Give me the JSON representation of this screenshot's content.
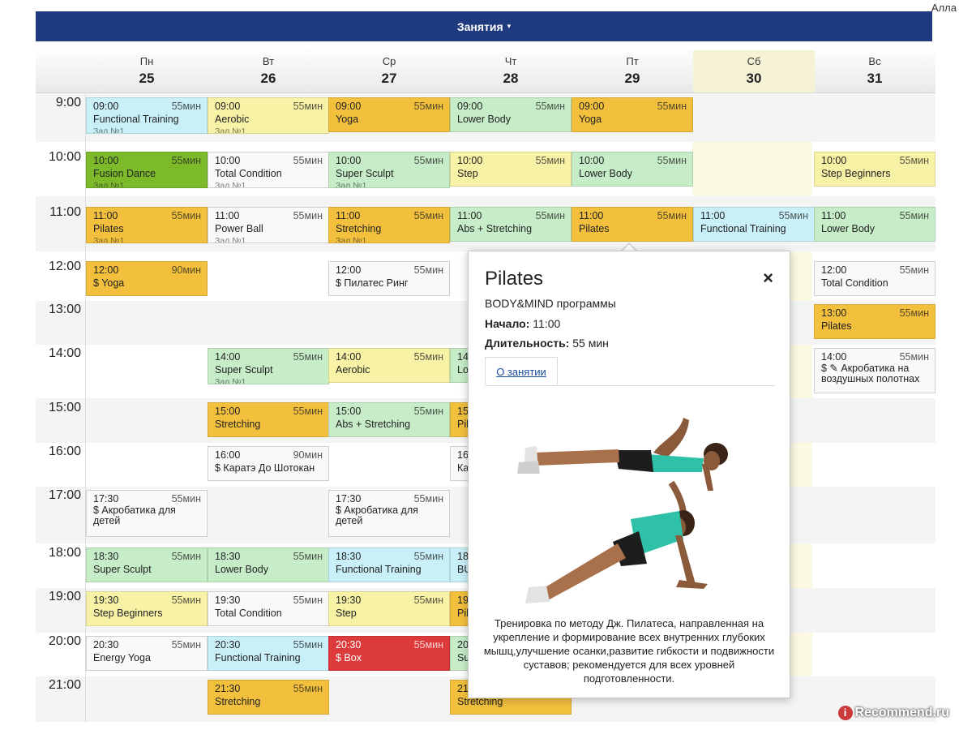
{
  "user": {
    "name": "Алла"
  },
  "topbar": {
    "label": "Занятия",
    "caret": "▾"
  },
  "days": [
    {
      "name": "Пн",
      "date": "25"
    },
    {
      "name": "Вт",
      "date": "26"
    },
    {
      "name": "Ср",
      "date": "27"
    },
    {
      "name": "Чт",
      "date": "28"
    },
    {
      "name": "Пт",
      "date": "29"
    },
    {
      "name": "Сб",
      "date": "30"
    },
    {
      "name": "Вс",
      "date": "31"
    }
  ],
  "times": [
    "9:00",
    "10:00",
    "11:00",
    "12:00",
    "13:00",
    "14:00",
    "15:00",
    "16:00",
    "17:00",
    "18:00",
    "19:00",
    "20:00",
    "21:00"
  ],
  "colors": {
    "cyan": "#c9f0f8",
    "yellow": "#f7f2a6",
    "orange": "#f2c03d",
    "green": "#c6edc8",
    "white": "#f9f9f9",
    "darkgreen": "#7cba2a",
    "red": "#dd3b3b",
    "topbar": "#1f3a7e"
  },
  "events": [
    {
      "day": 0,
      "slot": 0,
      "time": "09:00",
      "dur": "55мин",
      "title": "Functional Training",
      "room": "Зал №1",
      "color": "cyan"
    },
    {
      "day": 1,
      "slot": 0,
      "time": "09:00",
      "dur": "55мин",
      "title": "Aerobic",
      "room": "Зал №1",
      "color": "yellow"
    },
    {
      "day": 2,
      "slot": 0,
      "time": "09:00",
      "dur": "55мин",
      "title": "Yoga",
      "color": "orange"
    },
    {
      "day": 3,
      "slot": 0,
      "time": "09:00",
      "dur": "55мин",
      "title": "Lower Body",
      "color": "green"
    },
    {
      "day": 4,
      "slot": 0,
      "time": "09:00",
      "dur": "55мин",
      "title": "Yoga",
      "color": "orange"
    },
    {
      "day": 0,
      "slot": 1,
      "time": "10:00",
      "dur": "55мин",
      "title": "Fusion Dance",
      "room": "Зал №1",
      "color": "darkgreen"
    },
    {
      "day": 1,
      "slot": 1,
      "time": "10:00",
      "dur": "55мин",
      "title": "Total Condition",
      "room": "Зал №1",
      "color": "white"
    },
    {
      "day": 2,
      "slot": 1,
      "time": "10:00",
      "dur": "55мин",
      "title": "Super Sculpt",
      "room": "Зал №1",
      "color": "green"
    },
    {
      "day": 3,
      "slot": 1,
      "time": "10:00",
      "dur": "55мин",
      "title": "Step",
      "color": "yellow"
    },
    {
      "day": 4,
      "slot": 1,
      "time": "10:00",
      "dur": "55мин",
      "title": "Lower Body",
      "color": "green"
    },
    {
      "day": 6,
      "slot": 1,
      "time": "10:00",
      "dur": "55мин",
      "title": "Step Beginners",
      "color": "yellow"
    },
    {
      "day": 0,
      "slot": 2,
      "time": "11:00",
      "dur": "55мин",
      "title": "Pilates",
      "room": "Зал №1",
      "color": "orange"
    },
    {
      "day": 1,
      "slot": 2,
      "time": "11:00",
      "dur": "55мин",
      "title": "Power Ball",
      "room": "Зал №1",
      "color": "white"
    },
    {
      "day": 2,
      "slot": 2,
      "time": "11:00",
      "dur": "55мин",
      "title": "Stretching",
      "room": "Зал №1",
      "color": "orange"
    },
    {
      "day": 3,
      "slot": 2,
      "time": "11:00",
      "dur": "55мин",
      "title": "Abs + Stretching",
      "color": "green"
    },
    {
      "day": 4,
      "slot": 2,
      "time": "11:00",
      "dur": "55мин",
      "title": "Pilates",
      "color": "orange"
    },
    {
      "day": 5,
      "slot": 2,
      "time": "11:00",
      "dur": "55мин",
      "title": "Functional Training",
      "color": "cyan"
    },
    {
      "day": 6,
      "slot": 2,
      "time": "11:00",
      "dur": "55мин",
      "title": "Lower Body",
      "color": "green"
    },
    {
      "day": 0,
      "slot": 3,
      "time": "12:00",
      "dur": "90мин",
      "title": "$ Yoga",
      "color": "orange"
    },
    {
      "day": 2,
      "slot": 3,
      "time": "12:00",
      "dur": "55мин",
      "title": "$ Пилатес Ринг",
      "color": "white"
    },
    {
      "day": 6,
      "slot": 3,
      "time": "12:00",
      "dur": "55мин",
      "title": "Total Condition",
      "color": "white"
    },
    {
      "day": 6,
      "slot": 4,
      "time": "13:00",
      "dur": "55мин",
      "title": "Pilates",
      "color": "orange"
    },
    {
      "day": 1,
      "slot": 5,
      "time": "14:00",
      "dur": "55мин",
      "title": "Super Sculpt",
      "room": "Зал №1",
      "color": "green"
    },
    {
      "day": 2,
      "slot": 5,
      "time": "14:00",
      "dur": "55мин",
      "title": "Aerobic",
      "color": "yellow"
    },
    {
      "day": 6,
      "slot": 5,
      "time": "14:00",
      "dur": "55мин",
      "title": "$ ✎ Акробатика на воздушных полотнах",
      "color": "white",
      "wrap": true
    },
    {
      "day": 1,
      "slot": 6,
      "time": "15:00",
      "dur": "55мин",
      "title": "Stretching",
      "color": "orange"
    },
    {
      "day": 2,
      "slot": 6,
      "time": "15:00",
      "dur": "55мин",
      "title": "Abs + Stretching",
      "color": "green"
    },
    {
      "day": 1,
      "slot": 7,
      "time": "16:00",
      "dur": "90мин",
      "title": "$ Каратэ До Шотокан",
      "color": "white"
    },
    {
      "day": 0,
      "slot": 8,
      "time": "17:30",
      "dur": "55мин",
      "title": "$ Акробатика для детей",
      "color": "white",
      "wrap": true
    },
    {
      "day": 2,
      "slot": 8,
      "time": "17:30",
      "dur": "55мин",
      "title": "$ Акробатика для детей",
      "color": "white",
      "wrap": true
    },
    {
      "day": 0,
      "slot": 9,
      "time": "18:30",
      "dur": "55мин",
      "title": "Super Sculpt",
      "color": "green"
    },
    {
      "day": 1,
      "slot": 9,
      "time": "18:30",
      "dur": "55мин",
      "title": "Lower Body",
      "color": "green"
    },
    {
      "day": 2,
      "slot": 9,
      "time": "18:30",
      "dur": "55мин",
      "title": "Functional Training",
      "color": "cyan"
    },
    {
      "day": 0,
      "slot": 10,
      "time": "19:30",
      "dur": "55мин",
      "title": "Step Beginners",
      "color": "yellow"
    },
    {
      "day": 1,
      "slot": 10,
      "time": "19:30",
      "dur": "55мин",
      "title": "Total Condition",
      "color": "white"
    },
    {
      "day": 2,
      "slot": 10,
      "time": "19:30",
      "dur": "55мин",
      "title": "Step",
      "color": "yellow"
    },
    {
      "day": 0,
      "slot": 11,
      "time": "20:30",
      "dur": "55мин",
      "title": "Energy Yoga",
      "color": "white"
    },
    {
      "day": 1,
      "slot": 11,
      "time": "20:30",
      "dur": "55мин",
      "title": "Functional Training",
      "color": "cyan"
    },
    {
      "day": 2,
      "slot": 11,
      "time": "20:30",
      "dur": "55мин",
      "title": "$ Box",
      "color": "red"
    },
    {
      "day": 1,
      "slot": 12,
      "time": "21:30",
      "dur": "55мин",
      "title": "Stretching",
      "color": "orange"
    },
    {
      "day": 3,
      "slot": 12,
      "time": "21:30",
      "dur": "55мин",
      "title": "Stretching",
      "color": "orange"
    }
  ],
  "partial_events": [
    {
      "day": 3,
      "slot": 5,
      "text": "14",
      "text2": "Lo",
      "color": "green"
    },
    {
      "day": 3,
      "slot": 6,
      "text": "15",
      "text2": "Pil",
      "color": "orange"
    },
    {
      "day": 3,
      "slot": 7,
      "text": "16",
      "text2": "Ка",
      "color": "white"
    },
    {
      "day": 3,
      "slot": 9,
      "text": "18",
      "text2": "BU",
      "color": "cyan"
    },
    {
      "day": 3,
      "slot": 10,
      "text": "19",
      "text2": "Pil",
      "color": "orange"
    },
    {
      "day": 3,
      "slot": 11,
      "text": "20",
      "text2": "Su",
      "color": "green"
    },
    {
      "day": 5,
      "slot": 5,
      "text": "ах",
      "color": "white"
    }
  ],
  "popup": {
    "title": "Pilates",
    "close": "×",
    "category": "BODY&MIND программы",
    "start_label": "Начало:",
    "start_value": "11:00",
    "duration_label": "Длительность:",
    "duration_value": "55 мин",
    "tab_label": "О занятии",
    "description": "Тренировка по методу Дж. Пилатеса, направленная на укрепление и формирование всех внутренних глубоких мышц,улучшение осанки,развитие гибкости и подвижности суставов; рекомендуется для всех уровней подготовленности."
  },
  "watermark": {
    "badge": "i",
    "text": "Recommend.ru"
  }
}
